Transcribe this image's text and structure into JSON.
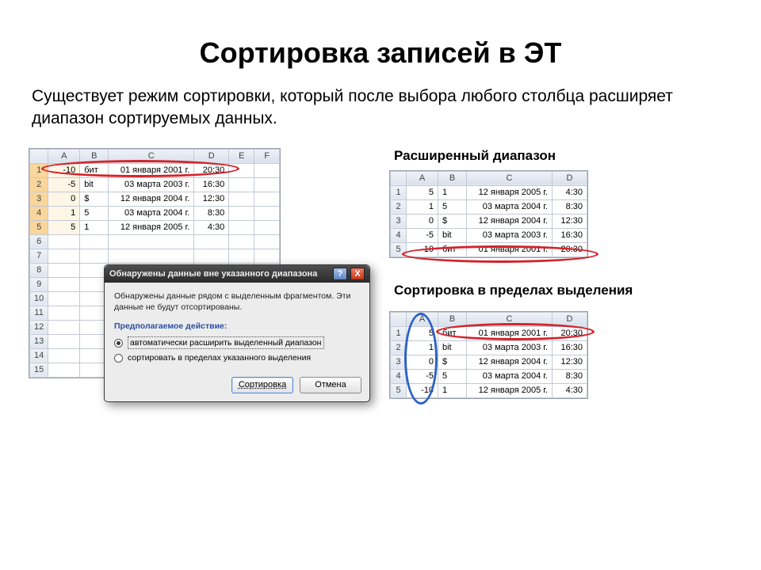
{
  "title": "Сортировка записей в ЭТ",
  "lead": "Существует режим сортировки, который после выбора любого столбца расширяет диапазон сортируемых данных.",
  "captions": {
    "ext": "Расширенный диапазон",
    "within": "Сортировка в пределах выделения"
  },
  "sheet_left": {
    "cols": [
      "A",
      "B",
      "C",
      "D",
      "E",
      "F"
    ],
    "rows": [
      {
        "n": 1,
        "a": "-10",
        "b": "бит",
        "c": "01 января 2001 г.",
        "d": "20:30"
      },
      {
        "n": 2,
        "a": "-5",
        "b": "bit",
        "c": "03 марта 2003 г.",
        "d": "16:30"
      },
      {
        "n": 3,
        "a": "0",
        "b": "$",
        "c": "12 января 2004 г.",
        "d": "12:30"
      },
      {
        "n": 4,
        "a": "1",
        "b": "5",
        "c": "03 марта 2004 г.",
        "d": "8:30"
      },
      {
        "n": 5,
        "a": "5",
        "b": "1",
        "c": "12 января 2005 г.",
        "d": "4:30"
      }
    ],
    "extra_rows": [
      6,
      7,
      8,
      9,
      10,
      11,
      12,
      13,
      14,
      15
    ]
  },
  "sheet_ext": {
    "cols": [
      "A",
      "B",
      "C",
      "D"
    ],
    "rows": [
      {
        "n": 1,
        "a": "5",
        "b": "1",
        "c": "12 января 2005 г.",
        "d": "4:30"
      },
      {
        "n": 2,
        "a": "1",
        "b": "5",
        "c": "03 марта 2004 г.",
        "d": "8:30"
      },
      {
        "n": 3,
        "a": "0",
        "b": "$",
        "c": "12 января 2004 г.",
        "d": "12:30"
      },
      {
        "n": 4,
        "a": "-5",
        "b": "bit",
        "c": "03 марта 2003 г.",
        "d": "16:30"
      },
      {
        "n": 5,
        "a": "-10",
        "b": "бит",
        "c": "01 января 2001 г.",
        "d": "20:30"
      }
    ]
  },
  "sheet_within": {
    "cols": [
      "A",
      "B",
      "C",
      "D"
    ],
    "rows": [
      {
        "n": 1,
        "a": "5",
        "b": "бит",
        "c": "01 января 2001 г.",
        "d": "20:30"
      },
      {
        "n": 2,
        "a": "1",
        "b": "bit",
        "c": "03 марта 2003 г.",
        "d": "16:30"
      },
      {
        "n": 3,
        "a": "0",
        "b": "$",
        "c": "12 января 2004 г.",
        "d": "12:30"
      },
      {
        "n": 4,
        "a": "-5",
        "b": "5",
        "c": "03 марта 2004 г.",
        "d": "8:30"
      },
      {
        "n": 5,
        "a": "-10",
        "b": "1",
        "c": "12 января 2005 г.",
        "d": "4:30"
      }
    ]
  },
  "dialog": {
    "title": "Обнаружены данные вне указанного диапазона",
    "note": "Обнаружены данные рядом с выделенным фрагментом. Эти данные не будут отсортированы.",
    "group": "Предполагаемое действие:",
    "opt1": "автоматически расширить выделенный диапазон",
    "opt2": "сортировать в пределах указанного выделения",
    "btn_sort": "Сортировка",
    "btn_cancel": "Отмена",
    "help": "?",
    "close": "X"
  }
}
